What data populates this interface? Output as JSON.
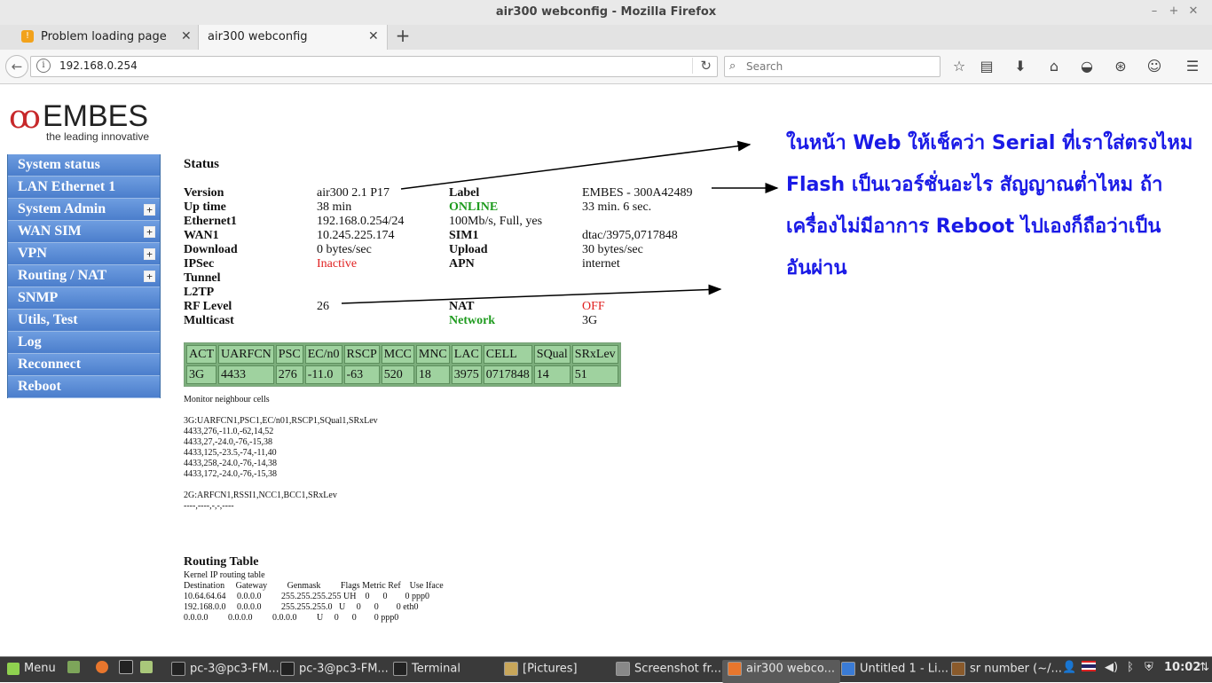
{
  "window": {
    "title": "air300 webconfig - Mozilla Firefox"
  },
  "tabs": [
    {
      "label": "Problem loading page"
    },
    {
      "label": "air300 webconfig"
    }
  ],
  "navbar": {
    "url": "192.168.0.254",
    "search_placeholder": "Search"
  },
  "logo": {
    "name": "EMBES",
    "tagline": "the leading innovative"
  },
  "menu": [
    {
      "label": "System status",
      "expandable": false
    },
    {
      "label": "LAN Ethernet 1",
      "expandable": false
    },
    {
      "label": "System Admin",
      "expandable": true
    },
    {
      "label": "WAN SIM",
      "expandable": true
    },
    {
      "label": "VPN",
      "expandable": true
    },
    {
      "label": "Routing / NAT",
      "expandable": true
    },
    {
      "label": "SNMP",
      "expandable": false
    },
    {
      "label": "Utils, Test",
      "expandable": false
    },
    {
      "label": "Log",
      "expandable": false
    },
    {
      "label": "Reconnect",
      "expandable": false
    },
    {
      "label": "Reboot",
      "expandable": false
    }
  ],
  "menu_expand_symbol": "+",
  "status": {
    "title": "Status",
    "rows": [
      {
        "l1": "Version",
        "v1": "air300 2.1 P17",
        "l2": "Label",
        "v2": "EMBES - 300A42489"
      },
      {
        "l1": "Up time",
        "v1": "38 min",
        "l2": "ONLINE",
        "v2": "33 min. 6 sec."
      },
      {
        "l1": "Ethernet1",
        "v1": "192.168.0.254/24",
        "l2": "100Mb/s, Full, yes",
        "v2": ""
      },
      {
        "l1": "WAN1",
        "v1": "10.245.225.174",
        "l2": "SIM1",
        "v2": "dtac/3975,0717848"
      },
      {
        "l1": "Download",
        "v1": "0 bytes/sec",
        "l2": "Upload",
        "v2": "30 bytes/sec"
      },
      {
        "l1": "IPSec",
        "v1": "Inactive",
        "l2": "APN",
        "v2": "internet"
      },
      {
        "l1": "Tunnel",
        "v1": "",
        "l2": "",
        "v2": ""
      },
      {
        "l1": "L2TP",
        "v1": "",
        "l2": "",
        "v2": ""
      },
      {
        "l1": "RF Level",
        "v1": "26",
        "l2": "NAT",
        "v2": "OFF"
      },
      {
        "l1": "Multicast",
        "v1": "",
        "l2": "Network",
        "v2": "3G"
      }
    ]
  },
  "cell_table": {
    "headers": [
      "ACT",
      "UARFCN",
      "PSC",
      "EC/n0",
      "RSCP",
      "MCC",
      "MNC",
      "LAC",
      "CELL",
      "SQual",
      "SRxLev"
    ],
    "row": [
      "3G",
      "4433",
      "276",
      "-11.0",
      "-63",
      "520",
      "18",
      "3975",
      "0717848",
      "14",
      "51"
    ]
  },
  "neighbours": {
    "title": "Monitor neighbour cells",
    "header_3g": "3G:UARFCN1,PSC1,EC/n01,RSCP1,SQual1,SRxLev",
    "lines_3g": [
      "4433,276,-11.0,-62,14,52",
      "4433,27,-24.0,-76,-15,38",
      "4433,125,-23.5,-74,-11,40",
      "4433,258,-24.0,-76,-14,38",
      "4433,172,-24.0,-76,-15,38"
    ],
    "header_2g": "2G:ARFCN1,RSSI1,NCC1,BCC1,SRxLev",
    "line_2g": "----,----,-,-,----"
  },
  "routing": {
    "title": "Routing Table",
    "subtitle": "Kernel IP routing table",
    "header": "Destination     Gateway         Genmask         Flags Metric Ref    Use Iface",
    "lines": [
      "10.64.64.64     0.0.0.0         255.255.255.255 UH    0      0        0 ppp0",
      "192.168.0.0     0.0.0.0         255.255.255.0   U     0      0        0 eth0",
      "0.0.0.0         0.0.0.0         0.0.0.0         U     0      0        0 ppp0"
    ]
  },
  "annotation": {
    "lines": [
      "ในหน้า Web ให้เช็คว่า Serial ที่เราใส่ตรงไหม",
      "Flash เป็นเวอร์ชั่นอะไร สัญญาณต่ำไหม ถ้า",
      "เครื่องไม่มีอาการ Reboot ไปเองก็ถือว่าเป็น",
      "อันผ่าน"
    ]
  },
  "taskbar": {
    "menu_label": "Menu",
    "items": [
      {
        "label": "pc-3@pc3-FM...",
        "icon": "terminal-icon"
      },
      {
        "label": "pc-3@pc3-FM...",
        "icon": "terminal-icon"
      },
      {
        "label": "Terminal",
        "icon": "terminal-icon"
      },
      {
        "label": "[Pictures]",
        "icon": "folder-icon"
      },
      {
        "label": "Screenshot fr...",
        "icon": "camera-icon"
      },
      {
        "label": "air300 webco...",
        "icon": "firefox-icon"
      },
      {
        "label": "Untitled 1 - Li...",
        "icon": "document-icon"
      },
      {
        "label": "sr number (~/...",
        "icon": "spreadsheet-icon"
      }
    ],
    "clock": "10:02"
  },
  "colors": {
    "menu_blue": "#5b8cd6",
    "online_green": "#1e9b1e",
    "alert_red": "#e02020",
    "table_green": "#9fd29f",
    "annotation_blue": "#1a1ae6"
  }
}
